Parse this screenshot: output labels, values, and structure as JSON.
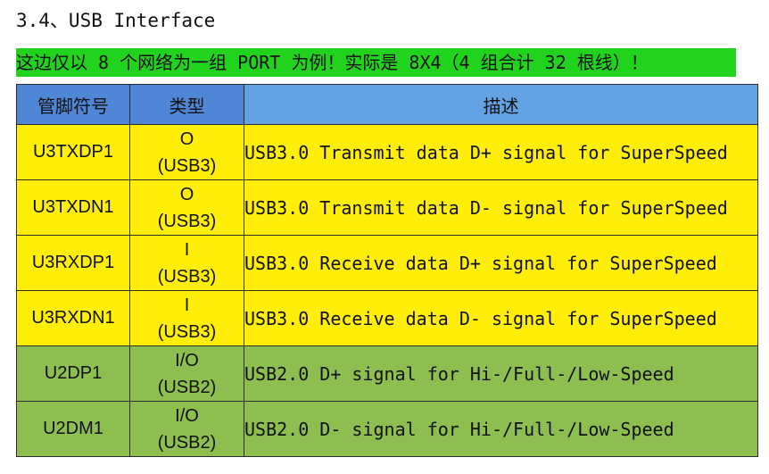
{
  "heading": "3.4、USB Interface",
  "note": "这边仅以 8 个网络为一组 PORT 为例！实际是 8X4（4 组合计 32 根线）！",
  "colors": {
    "note_highlight": "#22d31e",
    "header_bg": "#4f87d6",
    "header_desc_bg": "#63a3e4",
    "usb3_rows": "#ffee0a",
    "usb2_rows": "#8dbe4f"
  },
  "table": {
    "headers": [
      "管脚符号",
      "类型",
      "描述"
    ],
    "rows": [
      {
        "pin": "U3TXDP1",
        "type": "O",
        "type_sub": "(USB3)",
        "desc": "USB3.0 Transmit data D+ signal for SuperSpeed",
        "color": "yellow"
      },
      {
        "pin": "U3TXDN1",
        "type": "O",
        "type_sub": "(USB3)",
        "desc": "USB3.0 Transmit data D- signal for SuperSpeed",
        "color": "yellow"
      },
      {
        "pin": "U3RXDP1",
        "type": "I",
        "type_sub": "(USB3)",
        "desc": "USB3.0 Receive data D+ signal for SuperSpeed",
        "color": "yellow"
      },
      {
        "pin": "U3RXDN1",
        "type": "I",
        "type_sub": "(USB3)",
        "desc": "USB3.0 Receive data D- signal for SuperSpeed",
        "color": "yellow"
      },
      {
        "pin": "U2DP1",
        "type": "I/O",
        "type_sub": "(USB2)",
        "desc": "USB2.0 D+ signal for Hi-/Full-/Low-Speed",
        "color": "green"
      },
      {
        "pin": "U2DM1",
        "type": "I/O",
        "type_sub": "(USB2)",
        "desc": "USB2.0 D- signal for Hi-/Full-/Low-Speed",
        "color": "green"
      }
    ]
  }
}
